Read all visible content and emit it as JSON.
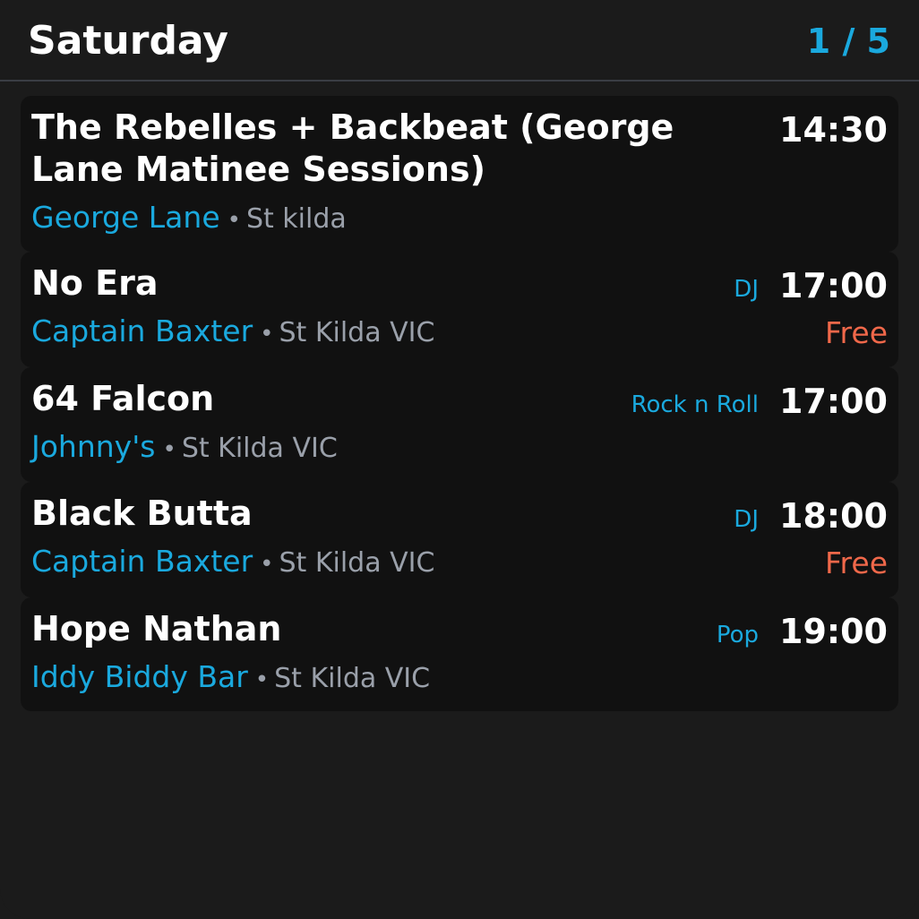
{
  "header": {
    "title": "Saturday",
    "counter": "1 / 5"
  },
  "events": [
    {
      "title": "The Rebelles + Backbeat (George Lane Matinee Sessions)",
      "time": "14:30",
      "genre": "",
      "venue": "George Lane",
      "separator": "•",
      "locality": "St kilda",
      "price": ""
    },
    {
      "title": "No Era",
      "time": "17:00",
      "genre": "DJ",
      "venue": "Captain Baxter",
      "separator": "•",
      "locality": "St Kilda VIC",
      "price": "Free"
    },
    {
      "title": "64 Falcon",
      "time": "17:00",
      "genre": "Rock n Roll",
      "venue": "Johnny's",
      "separator": "•",
      "locality": "St Kilda VIC",
      "price": ""
    },
    {
      "title": "Black Butta",
      "time": "18:00",
      "genre": "DJ",
      "venue": "Captain Baxter",
      "separator": "•",
      "locality": "St Kilda VIC",
      "price": "Free"
    },
    {
      "title": "Hope Nathan",
      "time": "19:00",
      "genre": "Pop",
      "venue": "Iddy Biddy Bar",
      "separator": "•",
      "locality": "St Kilda VIC",
      "price": ""
    }
  ],
  "colors": {
    "background": "#1b1b1b",
    "card": "#111111",
    "accent": "#1aa9de",
    "muted": "#9aa0aa",
    "price": "#f0684a",
    "divider": "#3a3d44"
  }
}
